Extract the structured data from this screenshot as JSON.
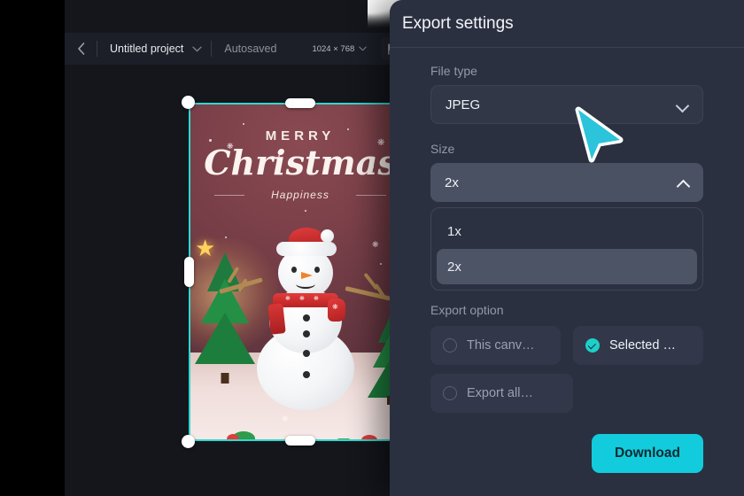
{
  "topbar": {
    "back_icon": "chevron-left-icon",
    "project_name": "Untitled project",
    "project_chevron": "chevron-down-icon",
    "autosaved": "Autosaved",
    "dimensions": "1024 × 768",
    "dimensions_chevron": "chevron-down-icon",
    "present_icon": "present-cursor-icon"
  },
  "canvas": {
    "artwork": {
      "line1": "MERRY",
      "line2": "Christmas",
      "line3": "Happiness"
    },
    "selection_color": "#2fd9d0"
  },
  "panel": {
    "title": "Export settings",
    "file_type": {
      "label": "File type",
      "value": "JPEG",
      "caret_icon": "chevron-down-icon"
    },
    "size": {
      "label": "Size",
      "value": "2x",
      "caret_icon": "chevron-up-icon",
      "options": [
        "1x",
        "2x"
      ],
      "selected_option": "2x"
    },
    "export_option": {
      "label": "Export option",
      "options": [
        {
          "label": "This canv…",
          "selected": false,
          "icon": "radio-off-icon"
        },
        {
          "label": "Selected …",
          "selected": true,
          "icon": "radio-checked-icon"
        },
        {
          "label": "Export all…",
          "selected": false,
          "icon": "radio-off-icon"
        }
      ]
    },
    "download_label": "Download",
    "accent_color": "#12ccdd",
    "background_color": "#2b3040"
  },
  "cursor": {
    "icon": "pointer-cursor-icon",
    "color": "#2bc4da"
  }
}
